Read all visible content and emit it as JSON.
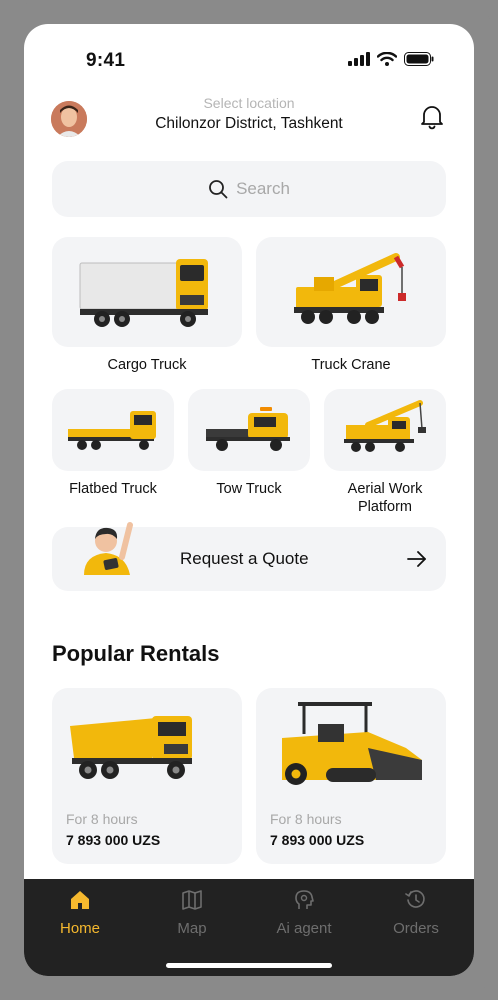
{
  "status_bar": {
    "time": "9:41"
  },
  "header": {
    "location_label": "Select location",
    "location_value": "Chilonzor District, Tashkent"
  },
  "search": {
    "placeholder": "Search"
  },
  "categories": [
    {
      "label": "Cargo Truck",
      "icon": "cargo-truck"
    },
    {
      "label": "Truck Crane",
      "icon": "truck-crane"
    },
    {
      "label": "Flatbed Truck",
      "icon": "flatbed-truck"
    },
    {
      "label": "Tow Truck",
      "icon": "tow-truck"
    },
    {
      "label": "Aerial Work Platform",
      "icon": "aerial-work-platform"
    }
  ],
  "quote": {
    "label": "Request a Quote"
  },
  "popular": {
    "title": "Popular Rentals",
    "items": [
      {
        "period": "For 8 hours",
        "price": "7 893 000 UZS",
        "icon": "dump-truck"
      },
      {
        "period": "For 8 hours",
        "price": "7 893 000 UZS",
        "icon": "asphalt-paver"
      }
    ]
  },
  "tabbar": {
    "tabs": [
      {
        "label": "Home",
        "icon": "home-icon",
        "active": true
      },
      {
        "label": "Map",
        "icon": "map-icon",
        "active": false
      },
      {
        "label": "Ai agent",
        "icon": "ai-agent-icon",
        "active": false
      },
      {
        "label": "Orders",
        "icon": "orders-icon",
        "active": false
      }
    ]
  },
  "colors": {
    "accent": "#f5b82e",
    "truck_yellow": "#f2b80c",
    "tab_bg": "#222222",
    "card_bg": "#f3f4f6",
    "inactive_tab": "#6e6e6e"
  }
}
